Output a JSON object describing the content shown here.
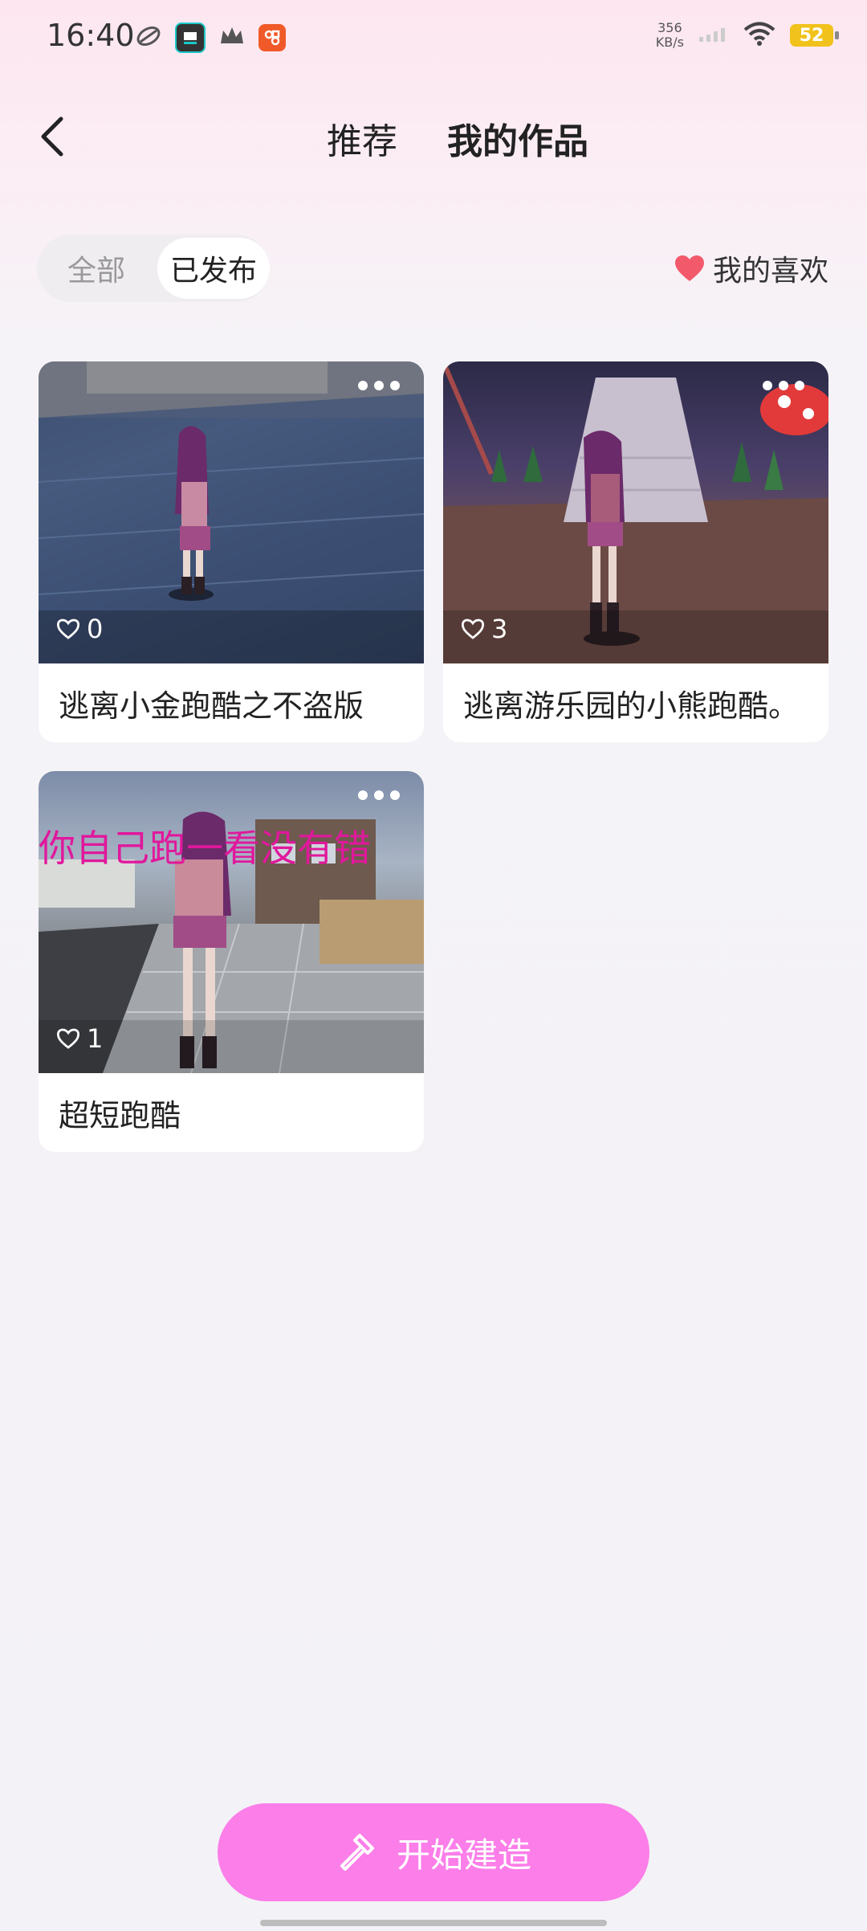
{
  "status_bar": {
    "time": "16:40",
    "net_speed_value": "356",
    "net_speed_unit": "KB/s",
    "battery": "52",
    "icons": [
      "swirl-icon",
      "app-badge-icon",
      "crown-icon",
      "store-icon",
      "signal-icon",
      "wifi-icon"
    ]
  },
  "header": {
    "tabs": [
      {
        "label": "推荐",
        "active": false
      },
      {
        "label": "我的作品",
        "active": true
      }
    ]
  },
  "filter": {
    "options": [
      {
        "label": "全部",
        "active": false
      },
      {
        "label": "已发布",
        "active": true
      }
    ],
    "my_likes_label": "我的喜欢"
  },
  "works": [
    {
      "title": "逃离小金跑酷之不盗版",
      "likes": "0",
      "thumb": "parkour-scene-rooftop"
    },
    {
      "title": "逃离游乐园的小熊跑酷。",
      "likes": "3",
      "thumb": "parkour-scene-amusement-park"
    },
    {
      "title": "超短跑酷",
      "likes": "1",
      "thumb": "parkour-scene-street",
      "overlay_text": "你自己跑一看没有错"
    }
  ],
  "build_button": {
    "label": "开始建造"
  },
  "colors": {
    "accent": "#fb7ee9",
    "heart": "#f25a6b",
    "overlay_text": "#e0189c"
  }
}
